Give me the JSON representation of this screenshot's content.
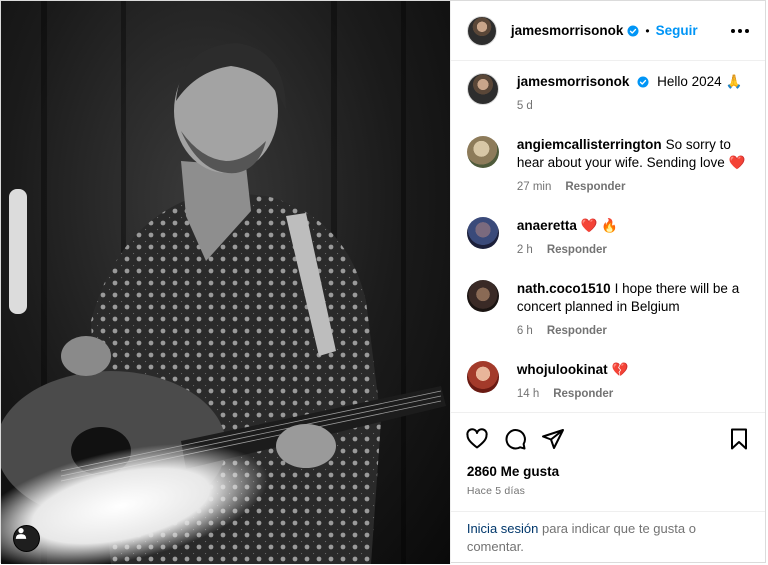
{
  "post": {
    "author": "jamesmorrisonok",
    "follow_label": "Seguir",
    "separator": "•",
    "caption": "Hello 2024 🙏",
    "caption_age": "5 d"
  },
  "comments": [
    {
      "user": "angiemcallisterrington",
      "text": "So sorry to hear about your wife. Sending love ❤️",
      "age": "27 min",
      "reply": "Responder"
    },
    {
      "user": "anaeretta",
      "text": "❤️ 🔥",
      "age": "2 h",
      "reply": "Responder"
    },
    {
      "user": "nath.coco1510",
      "text": "I hope there will be a concert planned in Belgium",
      "age": "6 h",
      "reply": "Responder"
    },
    {
      "user": "whojulookinat",
      "text": "💔",
      "age": "14 h",
      "reply": "Responder"
    }
  ],
  "likes": {
    "count_label": "2860 Me gusta",
    "posted": "Hace 5 días"
  },
  "login": {
    "link": "Inicia sesión",
    "rest": " para indicar que te gusta o comentar."
  },
  "icons": {
    "verified": "verified-badge-icon",
    "more": "more-options-icon",
    "like": "heart-icon",
    "comment": "comment-icon",
    "share": "share-icon",
    "save": "bookmark-icon",
    "tag": "user-tag-icon"
  },
  "colors": {
    "link_blue": "#0095f6",
    "verified": "#0095f6",
    "muted": "#737373",
    "login_link": "#00376b"
  }
}
